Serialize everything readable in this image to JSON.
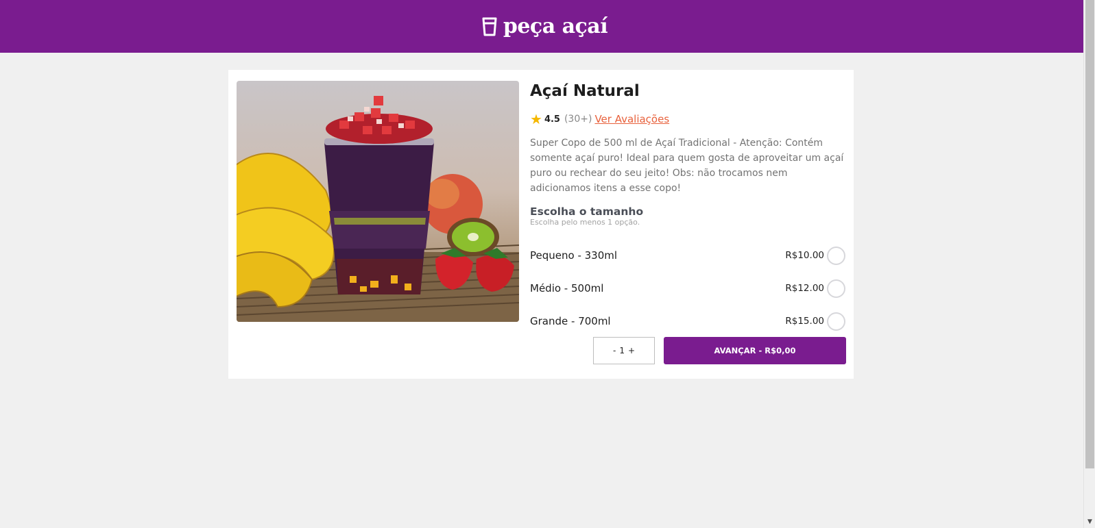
{
  "header": {
    "brand_name": "peça açaí",
    "brand_icon": "cup-icon",
    "background_color": "#7a1c8f"
  },
  "product": {
    "title": "Açaí Natural",
    "image_alt": "copo de açaí com morangos, bananas, manga e kiwi",
    "rating": {
      "score": "4.5",
      "count": "(30+)",
      "reviews_link": "Ver Avaliações",
      "star_icon": "star-icon",
      "star_color": "#f5b800"
    },
    "description": "Super Copo de 500 ml de Açaí Tradicional - Atenção: Contém somente açaí puro! Ideal para quem gosta de aproveitar um açaí puro ou rechear do seu jeito! Obs: não trocamos nem adicionamos itens a esse copo!"
  },
  "size_section": {
    "title": "Escolha o tamanho",
    "subtitle": "Escolha pelo menos 1 opção.",
    "options": [
      {
        "label": "Pequeno - 330ml",
        "price": "R$10.00",
        "selected": false
      },
      {
        "label": "Médio - 500ml",
        "price": "R$12.00",
        "selected": false
      },
      {
        "label": "Grande - 700ml",
        "price": "R$15.00",
        "selected": false
      }
    ]
  },
  "actions": {
    "quantity_decrement": "-",
    "quantity_value": "1",
    "quantity_increment": "+",
    "advance_label": "AVANÇAR - R$0,00",
    "accent_color": "#7a1c8f",
    "link_color": "#e8613c"
  }
}
